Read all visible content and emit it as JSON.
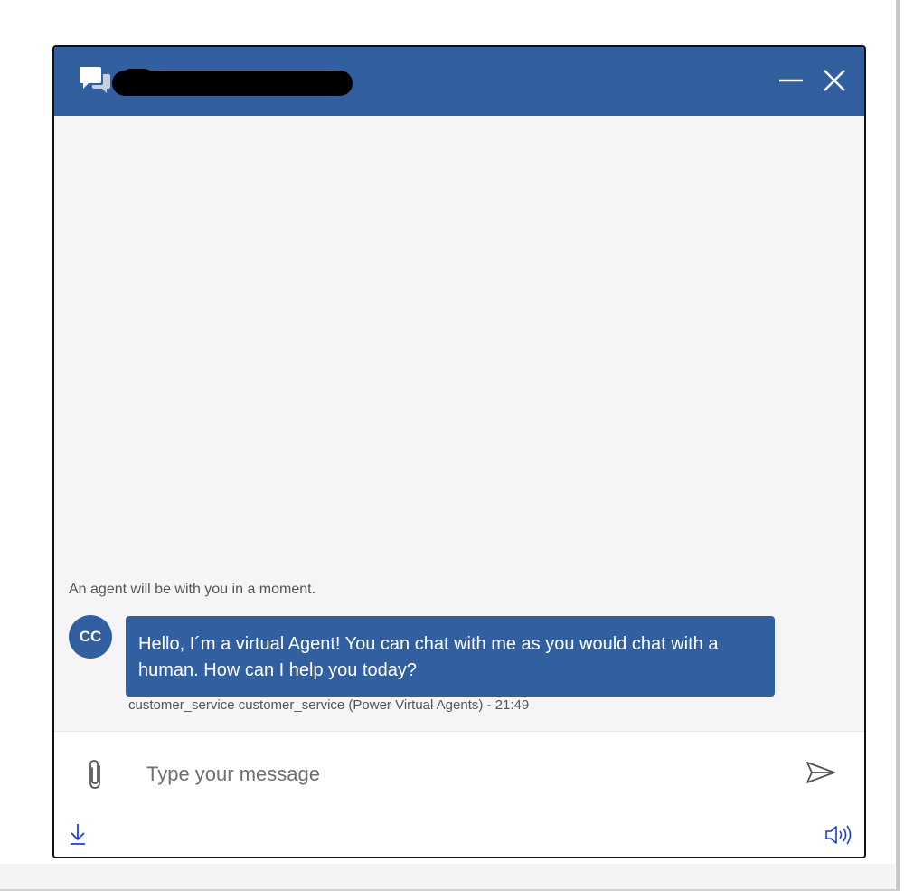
{
  "header": {
    "title_redacted": true,
    "icons": {
      "chat": "chat-bubbles-icon",
      "minimize": "minimize-icon",
      "close": "close-icon"
    }
  },
  "messages": {
    "system_note": "An agent will be with you in a moment.",
    "bot": {
      "avatar_initials": "CC",
      "text": "Hello, I´m a virtual Agent! You can chat with me as you would chat with a human. How can I help you today?",
      "meta": "customer_service customer_service (Power Virtual Agents) - 21:49"
    }
  },
  "composer": {
    "placeholder": "Type your message",
    "value": "",
    "icons": {
      "attach": "paperclip-icon",
      "send": "send-icon",
      "download": "download-icon",
      "speaker": "speaker-icon"
    }
  },
  "colors": {
    "accent": "#315fa0",
    "background": "#f5f5f8",
    "action_icon": "#1a3ed8"
  }
}
